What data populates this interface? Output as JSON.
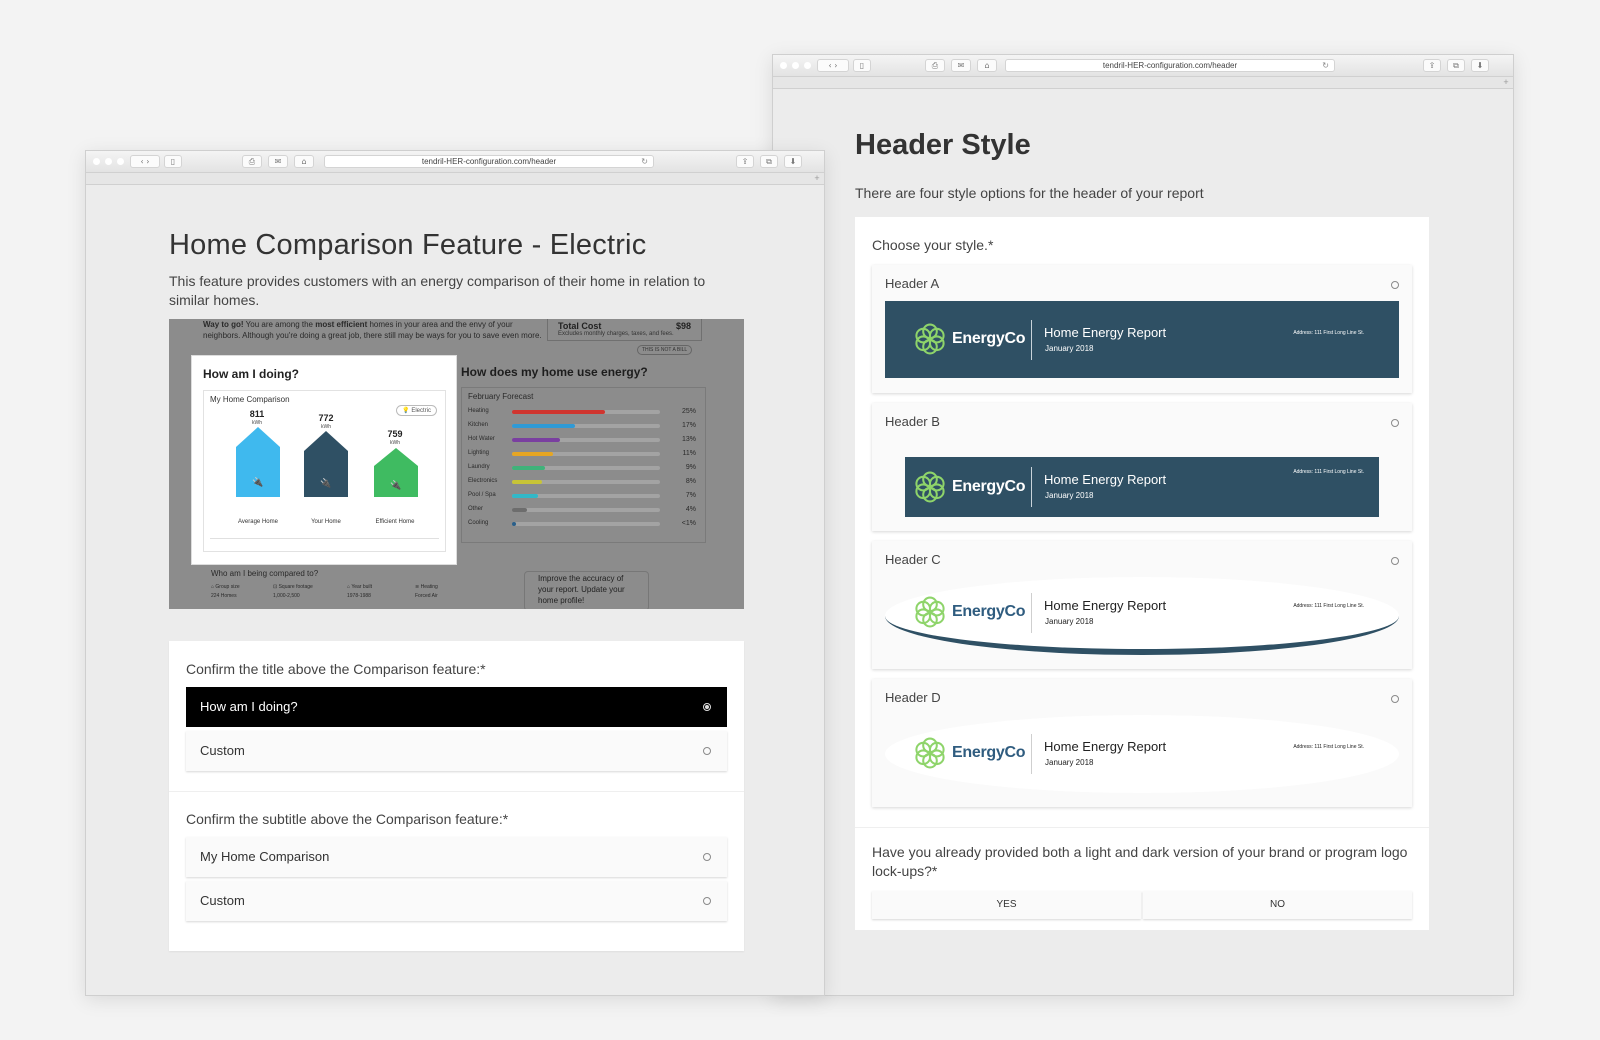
{
  "right_window": {
    "url": "tendril-HER-configuration.com/header",
    "title": "Header Style",
    "description": "There are four style options for the header of your report",
    "question": "Choose your style.*",
    "options": [
      {
        "name": "Header A",
        "brand": "EnergyCo",
        "report_title": "Home Energy Report",
        "report_date": "January 2018",
        "address": "Address: 111 First Long Line St."
      },
      {
        "name": "Header B",
        "brand": "EnergyCo",
        "report_title": "Home Energy Report",
        "report_date": "January 2018",
        "address": "Address: 111 First Long Line St."
      },
      {
        "name": "Header C",
        "brand": "EnergyCo",
        "report_title": "Home Energy Report",
        "report_date": "January 2018",
        "address": "Address: 111 First Long Line St."
      },
      {
        "name": "Header D",
        "brand": "EnergyCo",
        "report_title": "Home Energy Report",
        "report_date": "January 2018",
        "address": "Address: 111 First Long Line St."
      }
    ],
    "question2": "Have you already provided both a light and dark version of your brand or program logo lock-ups?*",
    "yes_label": "YES",
    "no_label": "NO"
  },
  "left_window": {
    "url": "tendril-HER-configuration.com/header",
    "title": "Home Comparison Feature - Electric",
    "description": "This feature provides customers with an energy comparison of their home in relation to similar homes.",
    "preview": {
      "intro_bold": "Way to go!",
      "intro_text_1": " You are among the ",
      "intro_bold_2": "most efficient",
      "intro_text_2": " homes in your area and the envy of your neighbors. Although you're doing a great job, there still may be ways for you to save even more.",
      "total_cost_label": "Total Cost",
      "total_cost_value": "$98",
      "total_cost_note": "Excludes monthly charges, taxes, and fees.",
      "not_a_bill": "THIS IS NOT A BILL",
      "card_title": "How am I doing?",
      "card_subtitle": "My Home Comparison",
      "electric_tag": "Electric",
      "homes": [
        {
          "label": "Average Home",
          "value": "811",
          "unit": "kWh"
        },
        {
          "label": "Your Home",
          "value": "772",
          "unit": "kWh"
        },
        {
          "label": "Efficient Home",
          "value": "759",
          "unit": "kWh"
        }
      ],
      "use_title": "How does my home use energy?",
      "forecast_title": "February Forecast",
      "usage": [
        {
          "label": "Heating",
          "pct": "25%",
          "value": 25,
          "color": "#d0352f"
        },
        {
          "label": "Kitchen",
          "pct": "17%",
          "value": 17,
          "color": "#2f9ad6"
        },
        {
          "label": "Hot Water",
          "pct": "13%",
          "value": 13,
          "color": "#7a3fa0"
        },
        {
          "label": "Lighting",
          "pct": "11%",
          "value": 11,
          "color": "#e6a623"
        },
        {
          "label": "Laundry",
          "pct": "9%",
          "value": 9,
          "color": "#3fb27a"
        },
        {
          "label": "Electronics",
          "pct": "8%",
          "value": 8,
          "color": "#c7c437"
        },
        {
          "label": "Pool / Spa",
          "pct": "7%",
          "value": 7,
          "color": "#32b8c8"
        },
        {
          "label": "Other",
          "pct": "4%",
          "value": 4,
          "color": "#6d6d6d"
        },
        {
          "label": "Cooling",
          "pct": "<1%",
          "value": 1,
          "color": "#2a5f8a"
        }
      ],
      "compared_title": "Who am I being compared to?",
      "stats": [
        {
          "label": "Group size",
          "value": "224 Homes"
        },
        {
          "label": "Square footage",
          "value": "1,000-2,500"
        },
        {
          "label": "Year built",
          "value": "1978-1988"
        },
        {
          "label": "Heating",
          "value": "Forced Air"
        }
      ],
      "improve_text": "Improve the accuracy of your report. Update your home profile!"
    },
    "question1": "Confirm the title above the Comparison feature:*",
    "q1_options": [
      "How am I doing?",
      "Custom"
    ],
    "question2": "Confirm the subtitle above the Comparison feature:*",
    "q2_options": [
      "My Home Comparison",
      "Custom"
    ]
  }
}
